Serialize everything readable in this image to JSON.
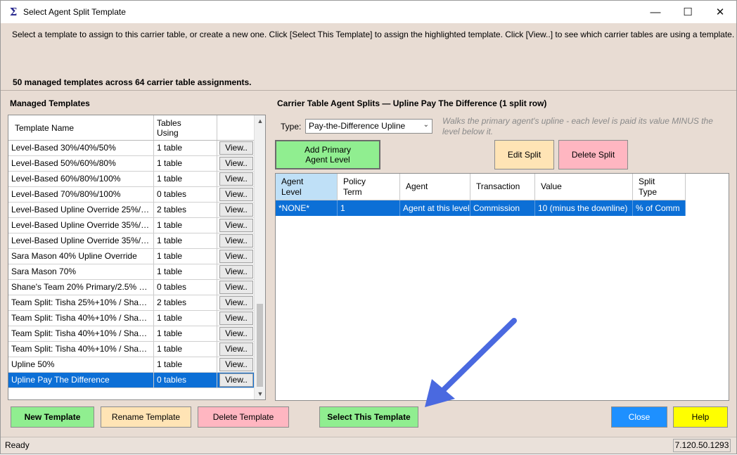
{
  "window": {
    "title": "Select Agent Split Template",
    "minimize_glyph": "—",
    "maximize_glyph": "☐",
    "close_glyph": "✕",
    "app_icon_glyph": "Σ"
  },
  "instructions": "Select a template to assign to this carrier table, or create a new one. Click [Select This Template] to assign the highlighted template. Click [View..] to see which carrier tables are using a template.",
  "summary": "50 managed templates across 64 carrier table assignments.",
  "managed": {
    "label": "Managed Templates",
    "col_name": "Template Name",
    "col_tables_line1": "Tables",
    "col_tables_line2": "Using",
    "view_label": "View..",
    "rows": [
      {
        "name": "Level-Based 30%/40%/50%",
        "tables": "1 table"
      },
      {
        "name": "Level-Based 50%/60%/80%",
        "tables": "1 table"
      },
      {
        "name": "Level-Based 60%/80%/100%",
        "tables": "1 table"
      },
      {
        "name": "Level-Based 70%/80%/100%",
        "tables": "0 tables"
      },
      {
        "name": "Level-Based Upline Override 25%/3...",
        "tables": "2 tables"
      },
      {
        "name": "Level-Based Upline Override 35%/4...",
        "tables": "1 table"
      },
      {
        "name": "Level-Based Upline Override 35%/4...",
        "tables": "1 table"
      },
      {
        "name": "Sara Mason 40% Upline Override",
        "tables": "1 table"
      },
      {
        "name": "Sara Mason 70%",
        "tables": "1 table"
      },
      {
        "name": "Shane's Team 20% Primary/2.5% Ja...",
        "tables": "0 tables"
      },
      {
        "name": "Team Split: Tisha 25%+10% / Shane...",
        "tables": "2 tables"
      },
      {
        "name": "Team Split: Tisha 40%+10% / Shane...",
        "tables": "1 table"
      },
      {
        "name": "Team Split: Tisha 40%+10% / Shane...",
        "tables": "1 table"
      },
      {
        "name": "Team Split: Tisha 40%+10% / Shane...",
        "tables": "1 table"
      },
      {
        "name": "Upline 50%",
        "tables": "1 table"
      },
      {
        "name": "Upline Pay The Difference",
        "tables": "0 tables"
      }
    ],
    "selected_index": 15
  },
  "splits": {
    "label": "Carrier Table Agent Splits — Upline Pay The Difference  (1 split row)",
    "type_label": "Type:",
    "type_value": "Pay-the-Difference Upline",
    "type_desc": "Walks the primary agent's upline - each level is paid its value MINUS the level below it.",
    "add_primary_line1": "Add Primary",
    "add_primary_line2": "Agent Level",
    "edit_split": "Edit Split",
    "delete_split": "Delete Split",
    "headers": {
      "agent_level_1": "Agent",
      "agent_level_2": "Level",
      "policy_term_1": "Policy",
      "policy_term_2": "Term",
      "agent": "Agent",
      "transaction": "Transaction",
      "value": "Value",
      "split_type_1": "Split",
      "split_type_2": "Type"
    },
    "row": {
      "agent_level": "*NONE*",
      "policy_term": "1",
      "agent": "Agent at this level",
      "transaction": "Commission",
      "value": "10 (minus the downline)",
      "split_type": "% of Comm"
    }
  },
  "footer": {
    "new_template": "New Template",
    "rename_template": "Rename Template",
    "delete_template": "Delete Template",
    "select_template": "Select This Template",
    "close": "Close",
    "help": "Help"
  },
  "status": {
    "text": "Ready",
    "version": "7.120.50.1293"
  },
  "colors": {
    "window_bg": "#e8dcd3",
    "selection": "#0c6fd6",
    "green_button": "#90ee90",
    "peach_button": "#ffe4b5",
    "pink_button": "#ffb6c1",
    "blue_button": "#1e90ff",
    "yellow_button": "#ffff00",
    "arrow": "#4a69e0"
  }
}
